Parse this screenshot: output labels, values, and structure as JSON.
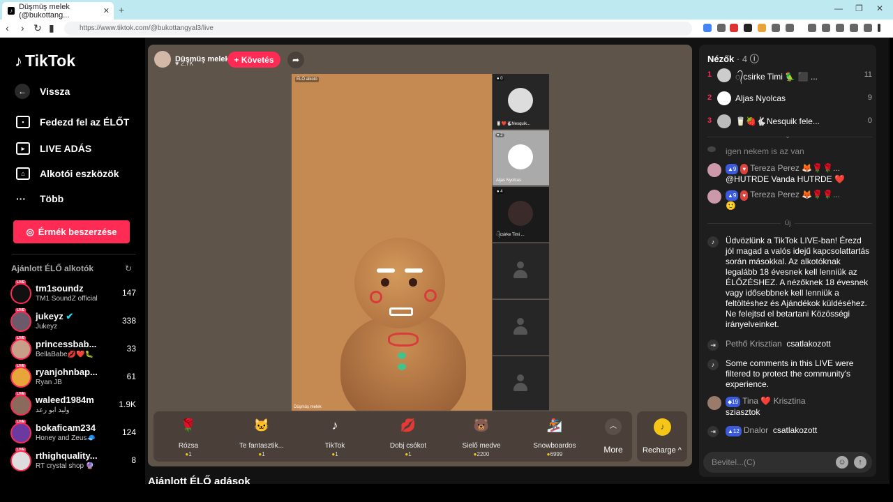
{
  "browser": {
    "tab_title": "Düşmüş melek (@bukottang...",
    "url": "https://www.tiktok.com/@bukottangyal3/live"
  },
  "sidebar": {
    "logo": "TikTok",
    "back": "Vissza",
    "nav": [
      "Fedezd fel az ÉLŐT",
      "LIVE ADÁS",
      "Alkotói eszközök",
      "Több"
    ],
    "coins_button": "Érmék beszerzése",
    "recommended_title": "Ajánlott ÉLŐ alkotók",
    "creators": [
      {
        "name": "tm1soundz",
        "sub": "TM1 SoundZ official",
        "count": "147"
      },
      {
        "name": "jukeyz",
        "sub": "Jukeyz",
        "count": "338"
      },
      {
        "name": "princessbab...",
        "sub": "BellaBabe💋❤️🐛",
        "count": "33"
      },
      {
        "name": "ryanjohnbap...",
        "sub": "Ryan JB",
        "count": "61"
      },
      {
        "name": "waleed1984m",
        "sub": "وليد ابو رعد",
        "count": "1.9K"
      },
      {
        "name": "bokaficam234",
        "sub": "Honey and Zeus🧢",
        "count": "124"
      },
      {
        "name": "rthighquality...",
        "sub": "RT crystal shop 🔮",
        "count": "8"
      }
    ]
  },
  "stream": {
    "host_name": "Düşmüş melek",
    "host_likes": "2.7K",
    "follow_label": "+ Követés",
    "video_label": "ÉLŐ alkotó",
    "video_name": "Düşmüş melek",
    "guests": [
      {
        "badge": "0",
        "name": "🥛❤️🐇Nesquik..."
      },
      {
        "badge": "2",
        "name": "Aljas Nyolcas"
      },
      {
        "badge": "4",
        "name": "᭄csirke Timi ..."
      }
    ],
    "gifts": [
      {
        "name": "Rózsa",
        "price": "1",
        "icon": "🌹"
      },
      {
        "name": "Te fantasztik...",
        "price": "1",
        "icon": "🐱"
      },
      {
        "name": "TikTok",
        "price": "1",
        "icon": "♪"
      },
      {
        "name": "Dobj csókot",
        "price": "1",
        "icon": "💋"
      },
      {
        "name": "Sielő medve",
        "price": "2200",
        "icon": "🐻"
      },
      {
        "name": "Snowboardos",
        "price": "6999",
        "icon": "🏂"
      }
    ],
    "more_label": "More",
    "recharge_label": "Recharge ^",
    "recommended_live_title": "Ajánlott ÉLŐ adások"
  },
  "viewers": {
    "title": "Nézők",
    "count": "· 4",
    "list": [
      {
        "rank": "1",
        "name": "᭄csirke Timi 🦜 ⬛ ...",
        "score": "11"
      },
      {
        "rank": "2",
        "name": "Aljas Nyolcas",
        "score": "9"
      },
      {
        "rank": "3",
        "name": "🥛🍓🐇Nesquik fele...",
        "score": "0"
      }
    ]
  },
  "chat": {
    "faded": "igen nekem is az van",
    "messages": [
      {
        "level": "9",
        "name": "Tereza Perez 🦊🌹🌹...",
        "text": "@HUTRDE Vanda HUTRDE ❤️"
      },
      {
        "level": "9",
        "name": "Tereza Perez 🦊🌹🌹...",
        "text": "🙂"
      }
    ],
    "new_label": "Új",
    "welcome": "Üdvözlünk a TikTok LIVE-ban! Érezd jól magad a valós idejű kapcsolattartás során másokkal. Az alkotóknak legalább 18 évesnek kell lenniük az ÉLŐZÉSHEZ. A nézőknek 18 évesnek vagy idősebbnek kell lenniük a feltöltéshez és Ajándékok küldéséhez. Ne felejtsd el betartani Közösségi irányelveinket.",
    "join1_name": "Pethő Krisztian",
    "joined": "csatlakozott",
    "filtered": "Some comments in this LIVE were filtered to protect the community's experience.",
    "msg3_level": "19",
    "msg3_name": "Tina ❤️ Krisztina",
    "msg3_text": "sziasztok",
    "join2_level": "12",
    "join2_name": "Dnalor",
    "input_placeholder": "Bevitel...(C)"
  }
}
